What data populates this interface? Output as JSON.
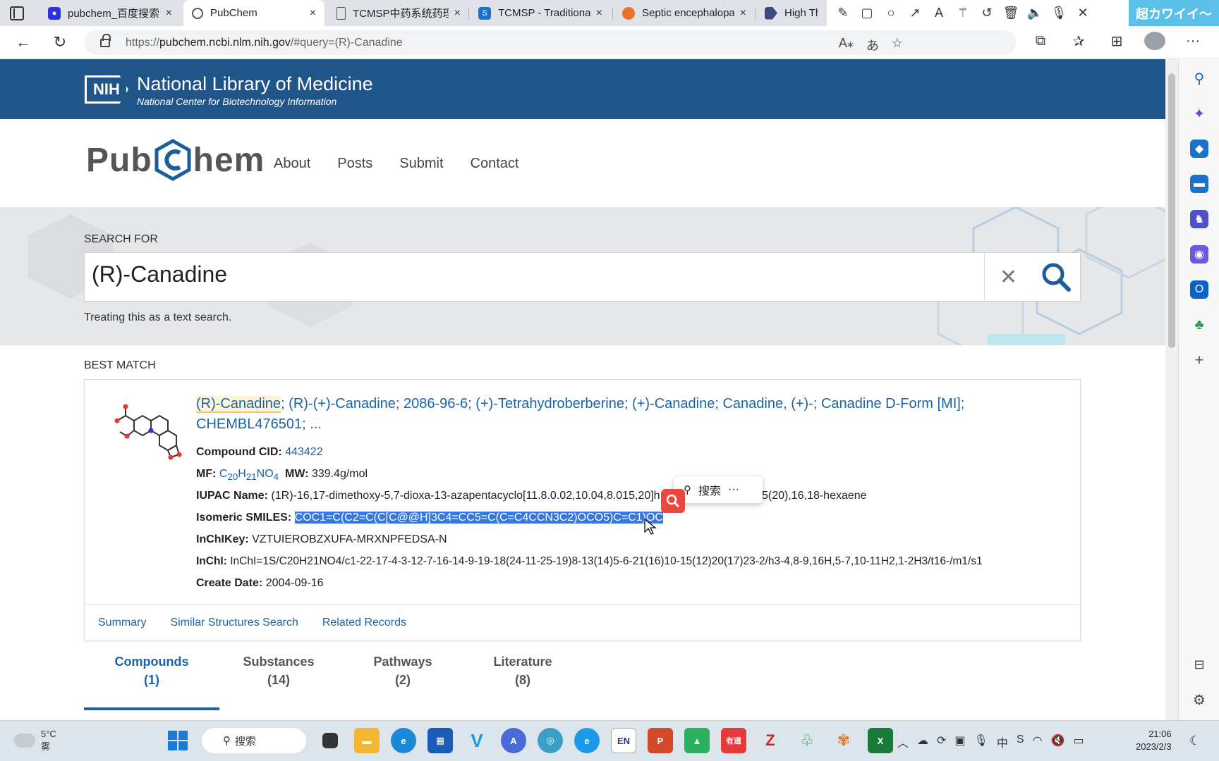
{
  "browser": {
    "tabs": [
      {
        "label": "pubchem_百度搜索",
        "favicon": "baidu-paw-icon",
        "color": "#2932e1"
      },
      {
        "label": "PubChem",
        "favicon": "pubchem-icon",
        "color": "#555555"
      },
      {
        "label": "TCMSP中药系统药理",
        "favicon": "document-icon",
        "color": "#555555"
      },
      {
        "label": "TCMSP - Traditional",
        "favicon": "tcmsp-icon",
        "color": "#1a73c8"
      },
      {
        "label": "Septic encephalopa",
        "favicon": "orange-circle-icon",
        "color": "#e8742c"
      },
      {
        "label": "High Thro",
        "favicon": "arrow-logo-icon",
        "color": "#3a4a7a"
      }
    ],
    "tab_close": "×",
    "jp_badge": "超カワイイ～",
    "url_prefix": "https://",
    "url_host": "pubchem.ncbi.nlm.nih.gov",
    "url_path": "/#query=(R)-Canadine"
  },
  "nih": {
    "logo": "NIH",
    "title": "National Library of Medicine",
    "subtitle": "National Center for Biotechnology Information"
  },
  "pubchem": {
    "logo_left": "Pub",
    "logo_right": "hem",
    "nav": [
      "About",
      "Posts",
      "Submit",
      "Contact"
    ]
  },
  "search": {
    "label": "SEARCH FOR",
    "value": "(R)-Canadine",
    "clear": "✕",
    "note": "Treating this as a text search."
  },
  "best_match": {
    "label": "BEST MATCH",
    "title_highlight": "(R)-Canadine",
    "title_rest": "; (R)-(+)-Canadine; 2086-96-6; (+)-Tetrahydroberberine; (+)-Canadine; Canadine, (+)-; Canadine D-Form [MI]; CHEMBL476501; ...",
    "cid_label": "Compound CID:",
    "cid": "443422",
    "mf_label": "MF:",
    "mf_c": "C",
    "mf_c_n": "20",
    "mf_h": "H",
    "mf_h_n": "21",
    "mf_rest": "NO",
    "mf_o_n": "4",
    "mw_label": "MW:",
    "mw": "339.4g/mol",
    "iupac_label": "IUPAC Name:",
    "iupac_start": "(1R)-16,17-dimethoxy-5,7-dioxa-13-azapentacyclo[11.8.0.02,10.04,8.015,20]h",
    "iupac_end": "5(20),16,18-hexaene",
    "smiles_label": "Isomeric SMILES:",
    "smiles": "COC1=C(C2=C(C[C@@H]3C4=CC5=C(C=C4CCN3C2)OCO5)C=C1)OC",
    "inchikey_label": "InChIKey:",
    "inchikey": "VZTUIEROBZXUFA-MRXNPFEDSA-N",
    "inchi_label": "InChI:",
    "inchi": "InChI=1S/C20H21NO4/c1-22-17-4-3-12-7-16-14-9-19-18(24-11-25-19)8-13(14)5-6-21(16)10-15(12)20(17)23-2/h3-4,8-9,16H,5-7,10-11H2,1-2H3/t16-/m1/s1",
    "date_label": "Create Date:",
    "date": "2004-09-16",
    "links": [
      "Summary",
      "Similar Structures Search",
      "Related Records"
    ]
  },
  "context_popup": {
    "search_label": "搜索",
    "more": "···"
  },
  "result_tabs": [
    {
      "label": "Compounds",
      "count": "(1)"
    },
    {
      "label": "Substances",
      "count": "(14)"
    },
    {
      "label": "Pathways",
      "count": "(2)"
    },
    {
      "label": "Literature",
      "count": "(8)"
    }
  ],
  "taskbar": {
    "temp": "5°C",
    "weather": "雾",
    "search_label": "搜索",
    "time": "21:06",
    "date": "2023/2/3"
  },
  "colors": {
    "nih_blue": "#20558a",
    "link_blue": "#1a63a8",
    "selection": "#3478e0",
    "pubchem_hex": "#1b5e9a"
  }
}
